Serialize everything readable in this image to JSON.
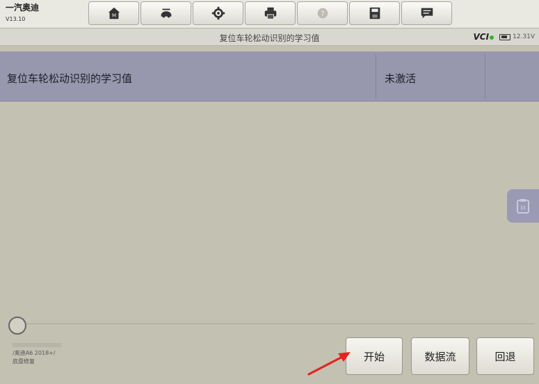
{
  "header": {
    "brand": "一汽奥迪",
    "version": "V13.10",
    "toolbar": [
      {
        "name": "home-icon"
      },
      {
        "name": "vehicle-swap-icon"
      },
      {
        "name": "settings-icon"
      },
      {
        "name": "print-icon"
      },
      {
        "name": "help-icon"
      },
      {
        "name": "save-icon"
      },
      {
        "name": "message-icon"
      }
    ]
  },
  "titlebar": {
    "title": "复位车轮松动识别的学习值",
    "vci_label": "VCI",
    "voltage": "12.31V"
  },
  "table": {
    "rows": [
      {
        "name": "复位车轮松动识别的学习值",
        "value": "未激活"
      }
    ]
  },
  "footer": {
    "vehicle_path": "/奥迪A6 2018+/",
    "vehicle_sub": "底盘修复"
  },
  "buttons": {
    "start": "开始",
    "datastream": "数据流",
    "back": "回退"
  },
  "colors": {
    "background": "#c3c1b2",
    "row_highlight": "#9797ad",
    "annotation_arrow": "#e8211c"
  }
}
